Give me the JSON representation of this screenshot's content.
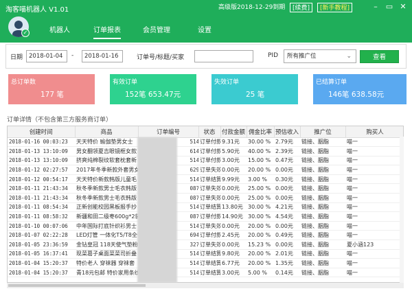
{
  "app": {
    "title": "淘客喵机器人 V1.01",
    "version_info": "高级版2018-12-29到期",
    "renew": "[续费]",
    "tutorial": "[新手教程]",
    "icons": [
      "avatar-icon",
      "minimize-icon",
      "restore-icon",
      "close-icon"
    ]
  },
  "nav": {
    "tabs": [
      "机器人",
      "订单报表",
      "会员管理",
      "设置"
    ],
    "active": "订单报表"
  },
  "search": {
    "date_label": "日期",
    "date_from": "2018-01-04",
    "date_sep": "-",
    "date_to": "2018-01-16",
    "order_label": "订单号/标题/买家",
    "order_value": "",
    "pid_label": "PID",
    "pid_value": "所有推广位",
    "view_button": "查看"
  },
  "cards": [
    {
      "title": "总订单数",
      "value": "177 笔",
      "color": "#f08d8e"
    },
    {
      "title": "有效订单",
      "value": "152笔  653.47元",
      "color": "#2ed28f"
    },
    {
      "title": "失效订单",
      "value": "25 笔",
      "color": "#3bcbd0"
    },
    {
      "title": "已结算订单",
      "value": "146笔  638.58元",
      "color": "#5aa9f0"
    }
  ],
  "table": {
    "caption": "订单详情（不包含第三方服务商订单）",
    "headers": [
      "创建时间",
      "商品",
      "订单编号",
      "状态",
      "付款金额",
      "佣金比率",
      "预估收入",
      "推广位",
      "购买人"
    ],
    "rows": [
      [
        "2018-01-16 00:03:23",
        "天天特价 瑜伽垫男女士",
        "122",
        "514",
        "订单付款",
        "9.31元",
        "30.00 %",
        "2.79元",
        "链接、胭脂",
        "喵一"
      ],
      [
        "2018-01-13 13:10:09",
        "男女翻领夏吉眼镜框女款",
        "121",
        "614",
        "订单付款",
        "5.90元",
        "40.00 %",
        "2.39元",
        "链接、胭脂",
        "喵一"
      ],
      [
        "2018-01-13 13:10:09",
        "挤爽纯棉裂纹软套枕套新",
        "121",
        "514",
        "订单付款",
        "3.00元",
        "15.00 %",
        "0.47元",
        "链接、胭脂",
        "喵一"
      ],
      [
        "2018-01-12 02:27:57",
        "2017年冬季新款外套男女",
        "106",
        "629",
        "订单失效",
        "0.00元",
        "20.00 %",
        "0.00元",
        "链接、胭脂",
        "喵一"
      ],
      [
        "2018-01-12 00:54:17",
        "天天特价新款韩版儿童毛",
        "121",
        "514",
        "订单结算",
        "9.99元",
        "3.00 %",
        "0.30元",
        "链接、胭脂",
        "喵一"
      ],
      [
        "2018-01-11 21:43:34",
        "秋冬季新款男士毛衣韩版",
        "113",
        "087",
        "订单失效",
        "0.00元",
        "25.00 %",
        "0.00元",
        "链接、胭脂",
        "喵一"
      ],
      [
        "2018-01-11 21:43:34",
        "秋冬季新款男士毛衣韩版",
        "113",
        "087",
        "订单失效",
        "0.00元",
        "25.00 %",
        "0.00元",
        "链接、胭脂",
        "喵一"
      ],
      [
        "2018-01-11 08:54:34",
        "正新创能校园黑板报手抄",
        "121",
        "514",
        "订单结算",
        "13.80元",
        "30.00 %",
        "4.21元",
        "链接、胭脂",
        "喵一"
      ],
      [
        "2018-01-11 08:58:32",
        "新疆和田二级枣600g*2袋",
        "113",
        "087",
        "订单付款",
        "14.90元",
        "30.00 %",
        "4.54元",
        "链接、胭脂",
        "喵一"
      ],
      [
        "2018-01-10 00:07:06",
        "中年国际打底针织衫男士",
        "118",
        "514",
        "订单失效",
        "0.00元",
        "20.00 %",
        "0.00元",
        "链接、胭脂",
        "喵一"
      ],
      [
        "2018-01-07 02:22:28",
        "LED灯管 一体化T5/T8全套",
        "110",
        "694",
        "订单付款",
        "2.45元",
        "20.00 %",
        "0.49元",
        "链接、胭脂",
        "喵一"
      ],
      [
        "2018-01-05 23:36:59",
        "金钻皇冠 118天使气垫粉",
        "111",
        "327",
        "订单失效",
        "0.00元",
        "15.23 %",
        "0.00元",
        "链接、胭脂",
        "夏小涵123"
      ],
      [
        "2018-01-05 16:37:41",
        "现菜葛子桌面菜菜司折叠",
        "121",
        "514",
        "订单结算",
        "9.80元",
        "20.00 %",
        "2.01元",
        "链接、胭脂",
        "喵一"
      ],
      [
        "2018-01-04 15:20:37",
        "特价老人 穿袜器 穿袜套",
        "121",
        "514",
        "订单结算",
        "6.77元",
        "20.00 %",
        "1.35元",
        "链接、胭脂",
        "喵一"
      ],
      [
        "2018-01-04 15:20:37",
        "青18元包邮 特价家用条纹",
        "121",
        "514",
        "订单结算",
        "3.00元",
        "5.00 %",
        "0.14元",
        "链接、胭脂",
        "喵一"
      ]
    ]
  }
}
